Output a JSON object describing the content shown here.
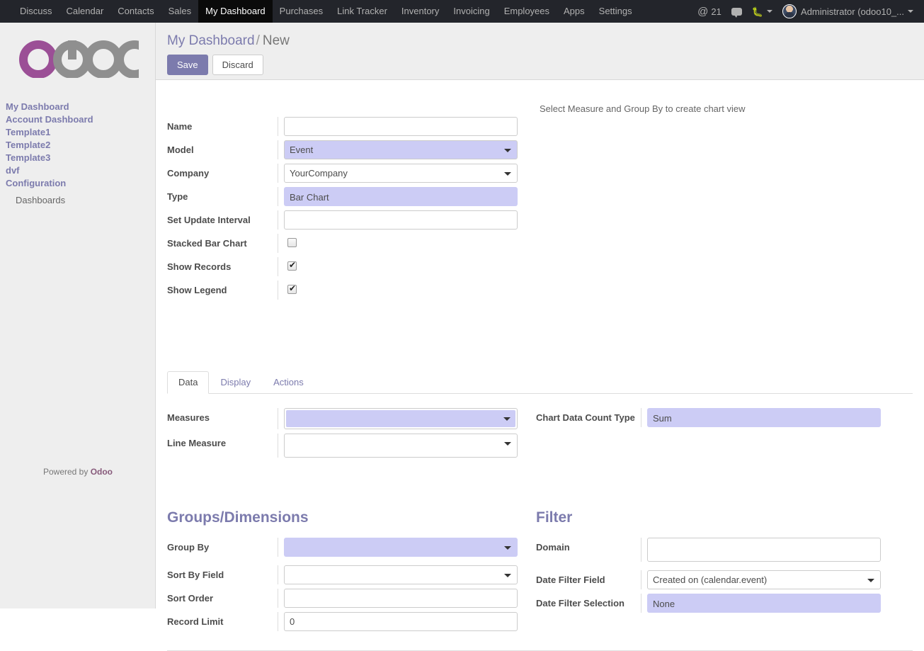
{
  "topbar": {
    "menu_items": [
      {
        "label": "Discuss",
        "active": false
      },
      {
        "label": "Calendar",
        "active": false
      },
      {
        "label": "Contacts",
        "active": false
      },
      {
        "label": "Sales",
        "active": false
      },
      {
        "label": "My Dashboard",
        "active": true
      },
      {
        "label": "Purchases",
        "active": false
      },
      {
        "label": "Link Tracker",
        "active": false
      },
      {
        "label": "Inventory",
        "active": false
      },
      {
        "label": "Invoicing",
        "active": false
      },
      {
        "label": "Employees",
        "active": false
      },
      {
        "label": "Apps",
        "active": false
      },
      {
        "label": "Settings",
        "active": false
      }
    ],
    "mention_icon": "at-icon",
    "mention_count": "21",
    "messages_icon": "speech-bubble-icon",
    "debug_icon": "bug-icon",
    "user_name": "Administrator (odoo10_...",
    "background_color": "#23252b",
    "active_color": "#0a0a0a"
  },
  "sidebar": {
    "logo_text": "odoo",
    "logo_accent_color": "#9b4f96",
    "logo_gray_color": "#8f8f8f",
    "items": [
      {
        "label": "My Dashboard"
      },
      {
        "label": "Account Dashboard"
      },
      {
        "label": "Template1"
      },
      {
        "label": "Template2"
      },
      {
        "label": "Template3"
      },
      {
        "label": "dvf"
      },
      {
        "label": "Configuration"
      }
    ],
    "sub_items": [
      {
        "label": "Dashboards"
      }
    ],
    "footer_prefix": "Powered by",
    "footer_brand": "Odoo"
  },
  "control_panel": {
    "breadcrumb_root": "My Dashboard",
    "breadcrumb_sep": "/",
    "breadcrumb_current": "New",
    "save_label": "Save",
    "discard_label": "Discard"
  },
  "main": {
    "hint": "Select Measure and Group By to create chart view",
    "fields": {
      "name": {
        "label": "Name",
        "value": ""
      },
      "model": {
        "label": "Model",
        "value": "Event"
      },
      "company": {
        "label": "Company",
        "value": "YourCompany"
      },
      "type": {
        "label": "Type",
        "value": "Bar Chart"
      },
      "update_interval": {
        "label": "Set Update Interval",
        "value": ""
      },
      "stacked_bar": {
        "label": "Stacked Bar Chart",
        "checked": false
      },
      "show_records": {
        "label": "Show Records",
        "checked": true
      },
      "show_legend": {
        "label": "Show Legend",
        "checked": true
      }
    },
    "tabs": [
      {
        "label": "Data",
        "active": true
      },
      {
        "label": "Display",
        "active": false
      },
      {
        "label": "Actions",
        "active": false
      }
    ],
    "data_tab": {
      "measures": {
        "label": "Measures",
        "value": ""
      },
      "line_measure": {
        "label": "Line Measure",
        "value": ""
      },
      "chart_data_count_type": {
        "label": "Chart Data Count Type",
        "value": "Sum"
      }
    },
    "groups_section": {
      "title": "Groups/Dimensions",
      "group_by": {
        "label": "Group By",
        "value": ""
      },
      "sort_by_field": {
        "label": "Sort By Field",
        "value": ""
      },
      "sort_order": {
        "label": "Sort Order",
        "value": ""
      },
      "record_limit": {
        "label": "Record Limit",
        "value": "0"
      }
    },
    "filter_section": {
      "title": "Filter",
      "domain": {
        "label": "Domain",
        "value": ""
      },
      "date_filter_field": {
        "label": "Date Filter Field",
        "value": "Created on (calendar.event)"
      },
      "date_filter_selection": {
        "label": "Date Filter Selection",
        "value": "None"
      }
    }
  },
  "colors": {
    "accent_purple": "#7c7bad",
    "highlight_lavender": "#ccccf5",
    "sidebar_bg": "#eeeeee"
  }
}
